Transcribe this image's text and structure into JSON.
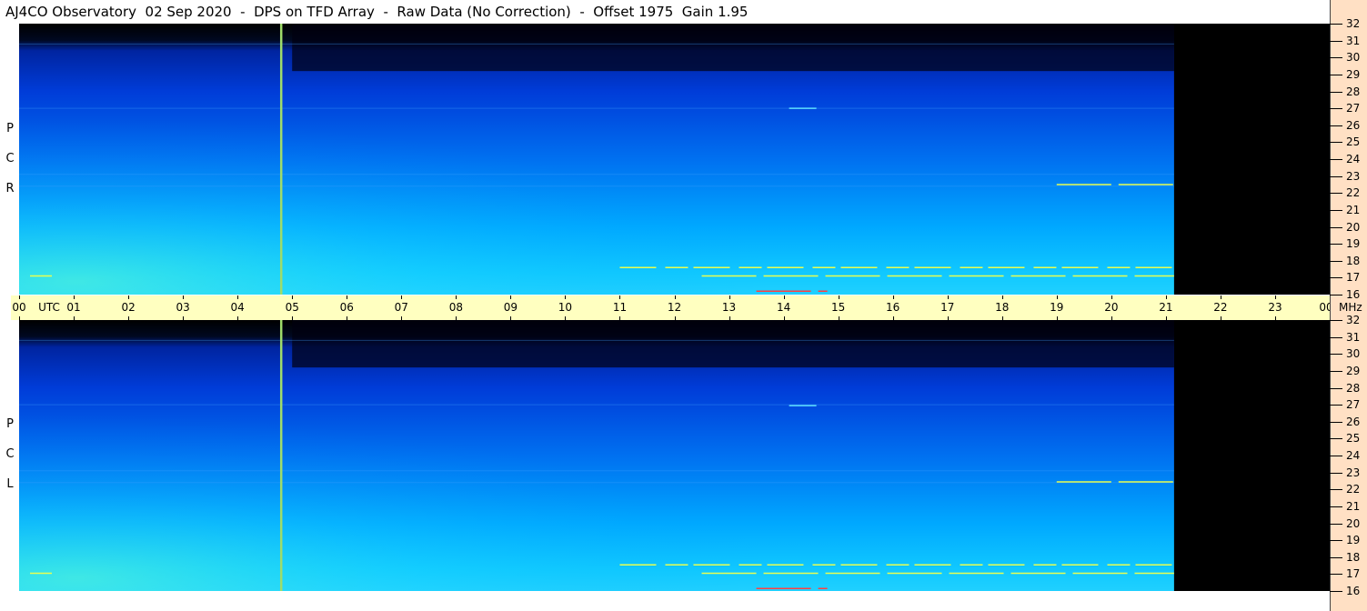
{
  "header": {
    "title": "AJ4CO Observatory  02 Sep 2020  -  DPS on TFD Array  -  Raw Data (No Correction)  -  Offset 1975  Gain 1.95"
  },
  "panels": {
    "rcp": {
      "letters": [
        "R",
        "C",
        "P"
      ]
    },
    "lcp": {
      "letters": [
        "L",
        "C",
        "P"
      ]
    }
  },
  "time_axis": {
    "unit_label": "UTC",
    "ticks": [
      "00",
      "01",
      "02",
      "03",
      "04",
      "05",
      "06",
      "07",
      "08",
      "09",
      "10",
      "11",
      "12",
      "13",
      "14",
      "15",
      "16",
      "17",
      "18",
      "19",
      "20",
      "21",
      "22",
      "23",
      "00"
    ]
  },
  "freq_axis": {
    "unit_label": "MHz",
    "ticks": [
      "32",
      "31",
      "30",
      "29",
      "28",
      "27",
      "26",
      "25",
      "24",
      "23",
      "22",
      "21",
      "20",
      "19",
      "18",
      "17",
      "16"
    ]
  },
  "colors": {
    "utc_bar": "#ffffc0",
    "freq_axis_bg": "#ffe0c4",
    "marker_line": "#9fdc6a",
    "spectrogram_low": "#000000",
    "spectrogram_mid": "#0040e0",
    "spectrogram_high": "#10c8ff"
  },
  "chart_data": {
    "type": "heatmap",
    "title": "AJ4CO Observatory  02 Sep 2020  -  DPS on TFD Array  -  Raw Data (No Correction)  -  Offset 1975  Gain 1.95",
    "x_axis": {
      "label": "UTC",
      "range": [
        0,
        24
      ],
      "ticks": [
        "00",
        "01",
        "02",
        "03",
        "04",
        "05",
        "06",
        "07",
        "08",
        "09",
        "10",
        "11",
        "12",
        "13",
        "14",
        "15",
        "16",
        "17",
        "18",
        "19",
        "20",
        "21",
        "22",
        "23",
        "00"
      ]
    },
    "y_axis": {
      "label": "MHz",
      "range": [
        16,
        32
      ],
      "ticks": [
        "32",
        "31",
        "30",
        "29",
        "28",
        "27",
        "26",
        "25",
        "24",
        "23",
        "22",
        "21",
        "20",
        "19",
        "18",
        "17",
        "16"
      ]
    },
    "panels": [
      "RCP",
      "LCP"
    ],
    "data_end_utc": 21.15,
    "marker_utc": 4.8,
    "colormap": [
      "#000000",
      "#001080",
      "#0040e0",
      "#0088ff",
      "#10c8ff",
      "#ffff60",
      "#ff2020"
    ],
    "rfi_lines": [
      {
        "utc": [
          11.0,
          21.15
        ],
        "mhz": 17.6
      },
      {
        "utc": [
          12.5,
          21.15
        ],
        "mhz": 17.1
      },
      {
        "utc": [
          13.5,
          14.8
        ],
        "mhz": 16.2
      },
      {
        "utc": [
          0.2,
          0.6
        ],
        "mhz": 17.1
      },
      {
        "utc": [
          19.0,
          21.15
        ],
        "mhz": 22.5
      },
      {
        "utc": [
          14.1,
          14.6
        ],
        "mhz": 27.0
      }
    ]
  }
}
